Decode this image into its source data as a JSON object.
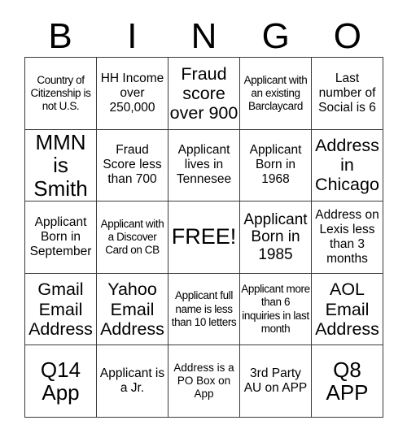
{
  "header": {
    "letters": [
      "B",
      "I",
      "N",
      "G",
      "O"
    ]
  },
  "grid": {
    "rows": 5,
    "columns": 5,
    "free_space_index": 12,
    "cells": [
      {
        "text": "Country of Citizenship is not U.S.",
        "size": "sm"
      },
      {
        "text": "HH Income over 250,000",
        "size": "md"
      },
      {
        "text": "Fraud score over 900",
        "size": "xl"
      },
      {
        "text": "Applicant with an existing Barclaycard",
        "size": "sm"
      },
      {
        "text": "Last number of Social is 6",
        "size": "md"
      },
      {
        "text": "MMN is Smith",
        "size": "xxl"
      },
      {
        "text": "Fraud Score less than 700",
        "size": "md"
      },
      {
        "text": "Applicant lives in Tennesee",
        "size": "md"
      },
      {
        "text": "Applicant Born in 1968",
        "size": "md"
      },
      {
        "text": "Address in Chicago",
        "size": "xl"
      },
      {
        "text": "Applicant Born in September",
        "size": "md"
      },
      {
        "text": "Applicant with a Discover Card on CB",
        "size": "sm"
      },
      {
        "text": "FREE!",
        "size": "free"
      },
      {
        "text": "Applicant Born in 1985",
        "size": "lg"
      },
      {
        "text": "Address on Lexis less than 3 months",
        "size": "md"
      },
      {
        "text": "Gmail Email Address",
        "size": "xl"
      },
      {
        "text": "Yahoo Email Address",
        "size": "xl"
      },
      {
        "text": "Applicant full name is less than 10 letters",
        "size": "sm"
      },
      {
        "text": "Applicant more than 6 inquiries in last month",
        "size": "sm"
      },
      {
        "text": "AOL Email Address",
        "size": "xl"
      },
      {
        "text": "Q14 App",
        "size": "xxl"
      },
      {
        "text": "Applicant is a Jr.",
        "size": "md"
      },
      {
        "text": "Address is a PO Box on App",
        "size": "sm"
      },
      {
        "text": "3rd Party AU on APP",
        "size": "md"
      },
      {
        "text": "Q8 APP",
        "size": "xxl"
      }
    ]
  },
  "colors": {
    "background": "#ffffff",
    "text": "#000000",
    "gridline": "#3a3a3a"
  }
}
